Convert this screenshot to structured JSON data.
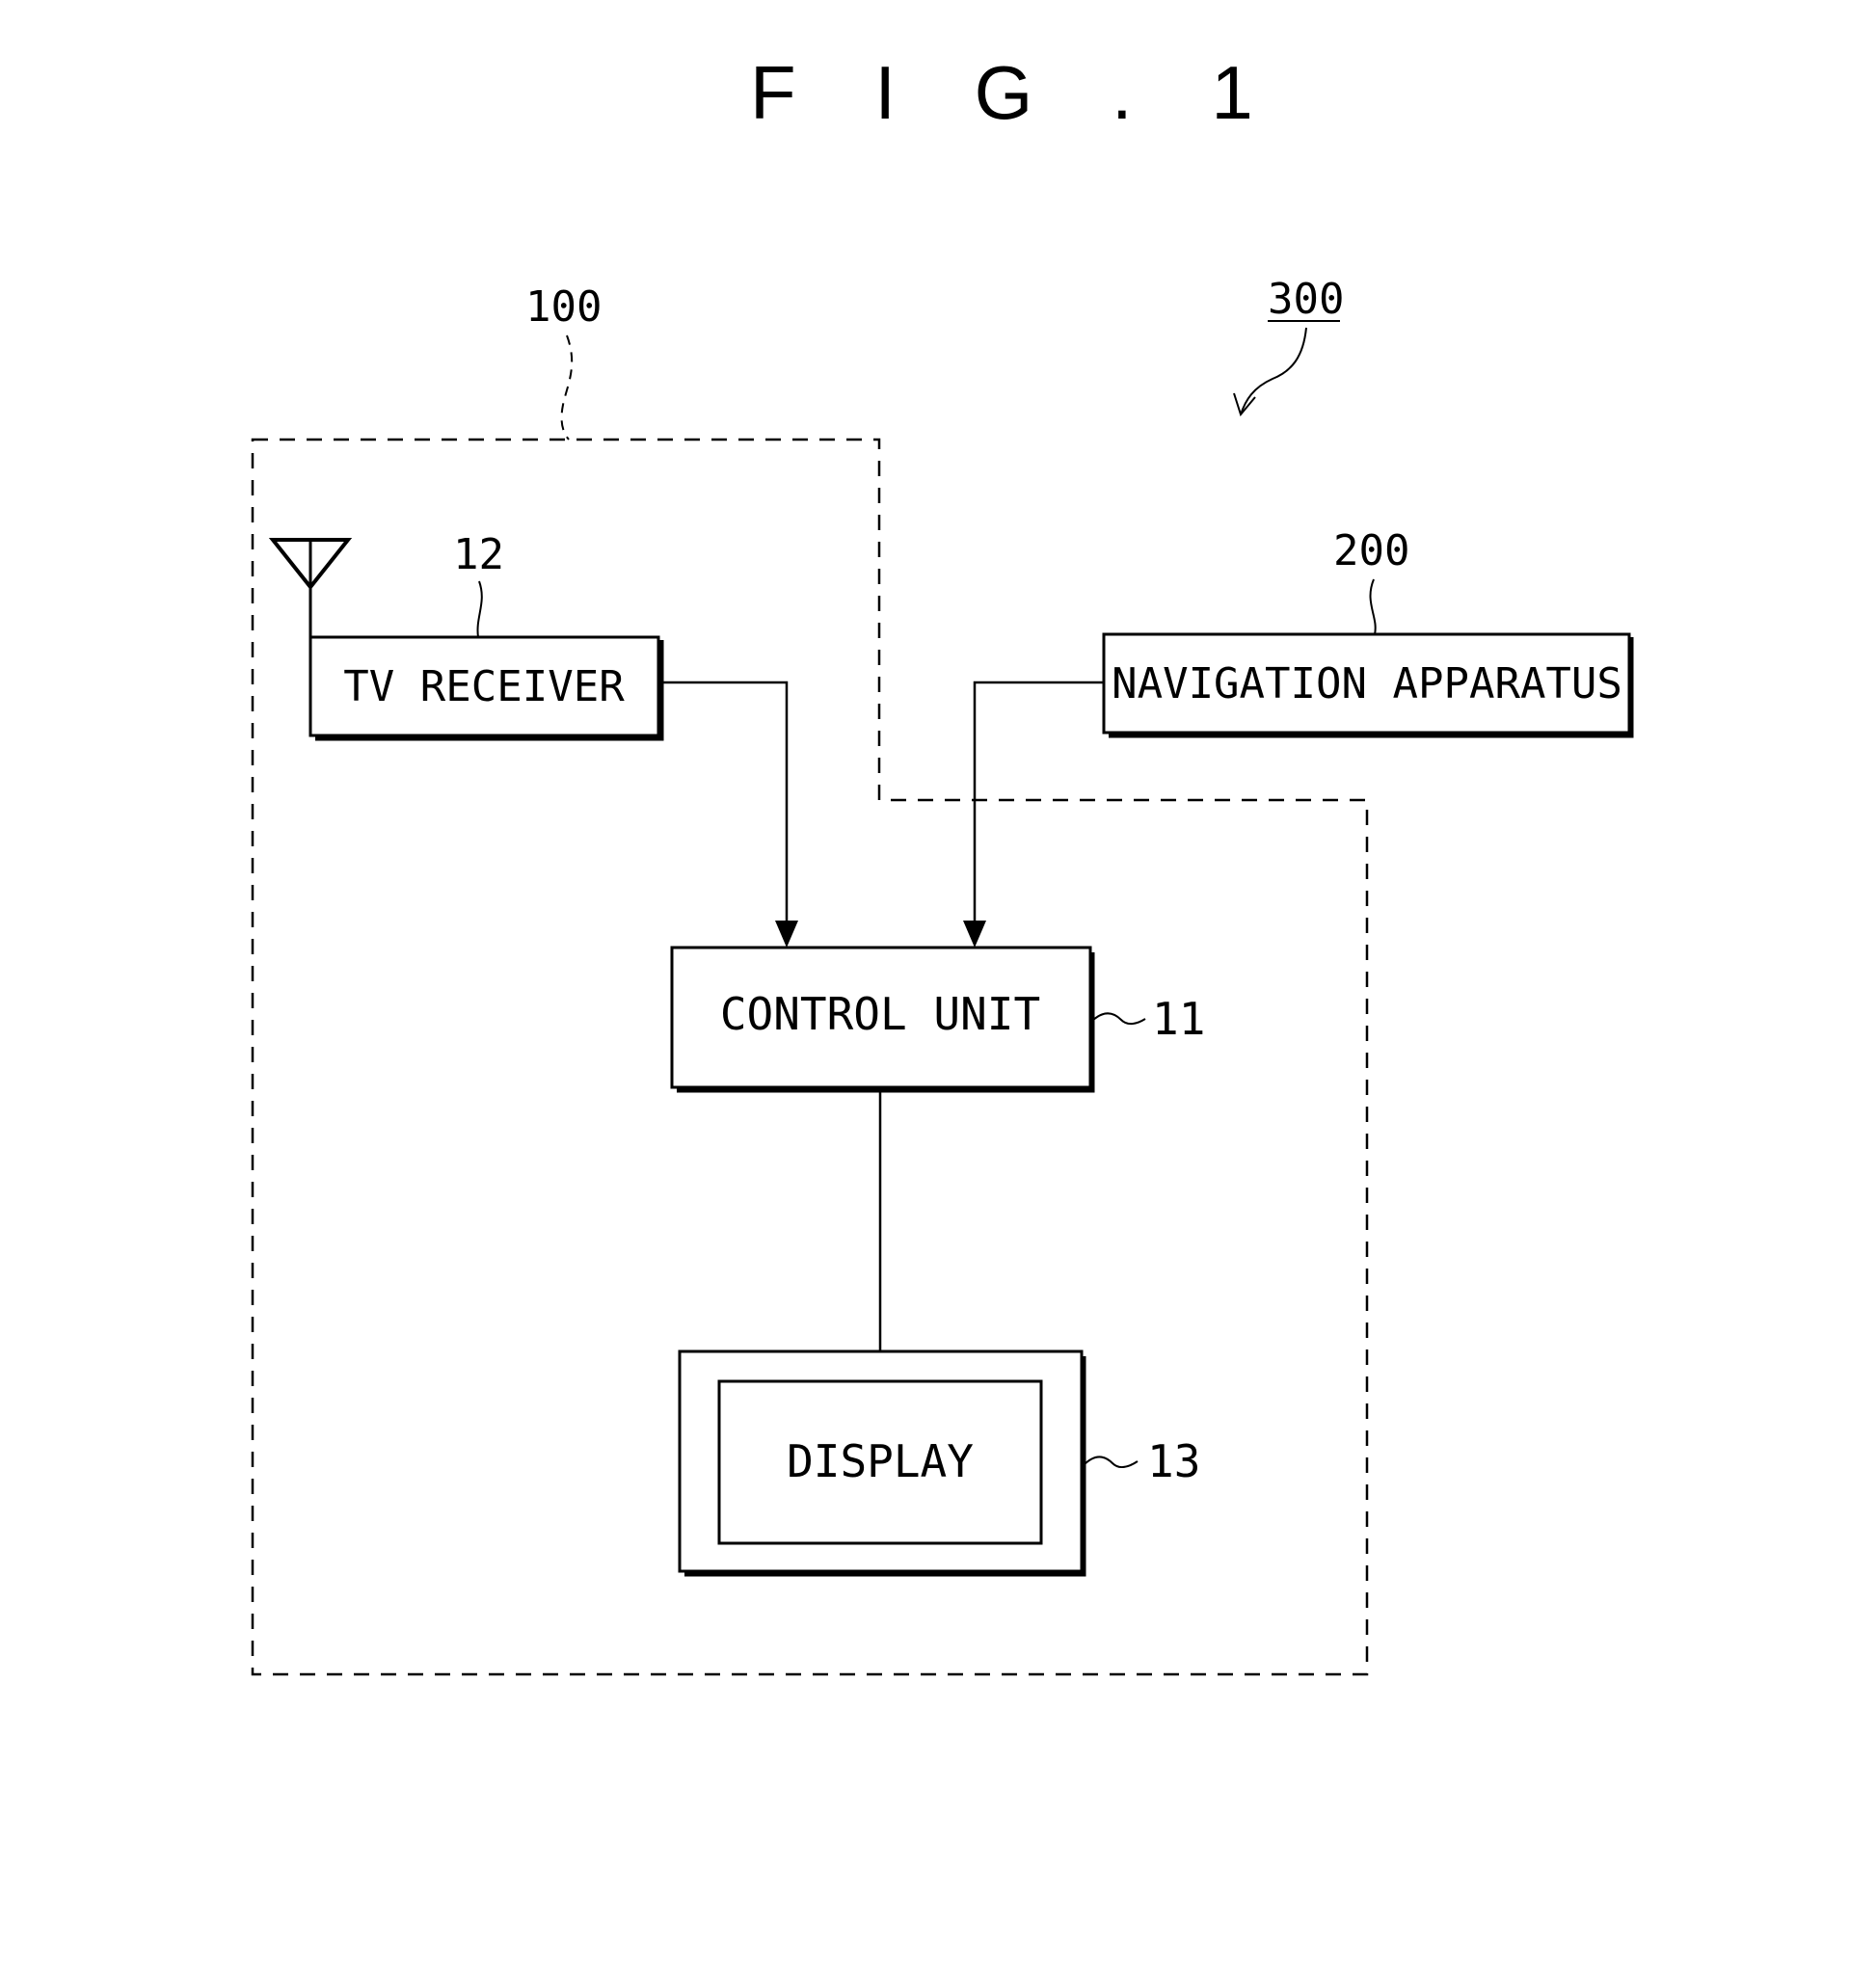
{
  "figure": {
    "title": "F I G . 1"
  },
  "blocks": {
    "tv_receiver": {
      "label": "TV RECEIVER",
      "ref": "12"
    },
    "navigation": {
      "label": "NAVIGATION APPARATUS",
      "ref": "200"
    },
    "control_unit": {
      "label": "CONTROL UNIT",
      "ref": "11"
    },
    "display": {
      "label": "DISPLAY",
      "ref": "13"
    }
  },
  "groups": {
    "device": {
      "ref": "100"
    },
    "system": {
      "ref": "300"
    }
  },
  "icons": {
    "antenna": "antenna-icon"
  },
  "colors": {
    "ink": "#000000",
    "paper": "#ffffff"
  }
}
